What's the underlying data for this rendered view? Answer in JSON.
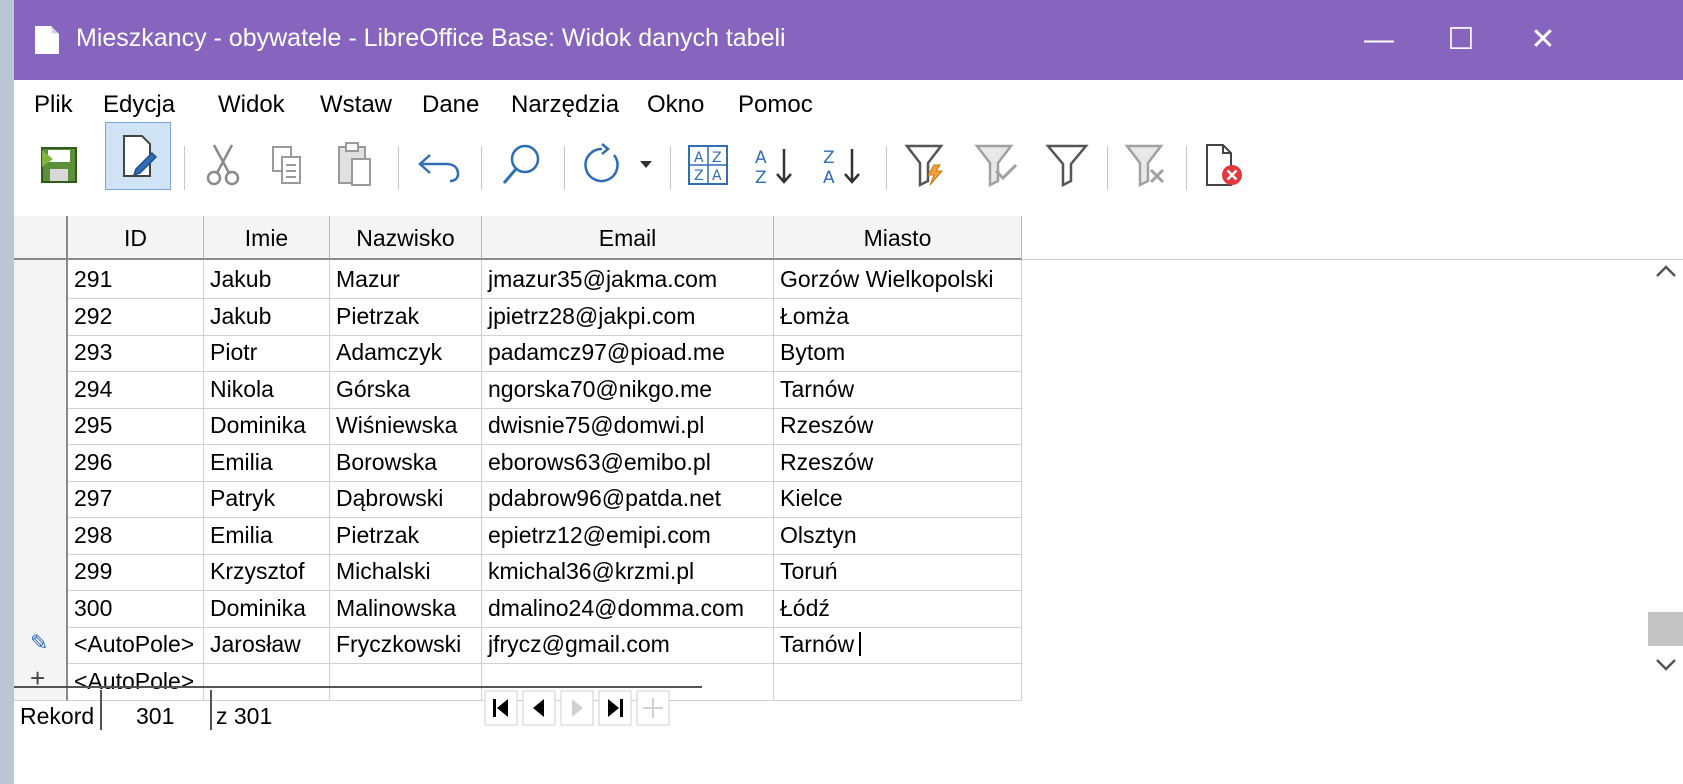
{
  "window": {
    "title": "Mieszkancy - obywatele - LibreOffice Base: Widok danych tabeli",
    "minimize_glyph": "—",
    "maximize_glyph": "☐",
    "close_glyph": "✕"
  },
  "menu": [
    {
      "label": "Plik"
    },
    {
      "label": "Edycja"
    },
    {
      "label": "Widok"
    },
    {
      "label": "Wstaw"
    },
    {
      "label": "Dane"
    },
    {
      "label": "Narzędzia"
    },
    {
      "label": "Okno"
    },
    {
      "label": "Pomoc"
    }
  ],
  "toolbar": {
    "icons": [
      "save-record-icon",
      "edit-data-icon",
      "cut-icon",
      "copy-icon",
      "paste-icon",
      "undo-icon",
      "find-icon",
      "refresh-icon",
      "refresh-dropdown-icon",
      "sort-icon",
      "sort-ascending-icon",
      "sort-descending-icon",
      "autofilter-icon",
      "apply-filter-icon",
      "standard-filter-icon",
      "reset-filter-icon",
      "delete-record-icon"
    ]
  },
  "table": {
    "columns": [
      "ID",
      "Imie",
      "Nazwisko",
      "Email",
      "Miasto"
    ],
    "rows": [
      [
        "291",
        "Jakub",
        "Mazur",
        "jmazur35@jakma.com",
        "Gorzów Wielkopolski"
      ],
      [
        "292",
        "Jakub",
        "Pietrzak",
        "jpietrz28@jakpi.com",
        "Łomża"
      ],
      [
        "293",
        "Piotr",
        "Adamczyk",
        "padamcz97@pioad.me",
        "Bytom"
      ],
      [
        "294",
        "Nikola",
        "Górska",
        "ngorska70@nikgo.me",
        "Tarnów"
      ],
      [
        "295",
        "Dominika",
        "Wiśniewska",
        "dwisnie75@domwi.pl",
        "Rzeszów"
      ],
      [
        "296",
        "Emilia",
        "Borowska",
        "eborows63@emibo.pl",
        "Rzeszów"
      ],
      [
        "297",
        "Patryk",
        "Dąbrowski",
        "pdabrow96@patda.net",
        "Kielce"
      ],
      [
        "298",
        "Emilia",
        "Pietrzak",
        "epietrz12@emipi.com",
        "Olsztyn"
      ],
      [
        "299",
        "Krzysztof",
        "Michalski",
        "kmichal36@krzmi.pl",
        "Toruń"
      ],
      [
        "300",
        "Dominika",
        "Malinowska",
        "dmalino24@domma.com",
        "Łódź"
      ],
      [
        "<AutoPole>",
        "Jarosław",
        "Fryczkowski",
        "jfrycz@gmail.com",
        "Tarnów"
      ],
      [
        "<AutoPole>",
        "",
        "",
        "",
        ""
      ]
    ],
    "row_markers": [
      "",
      "",
      "",
      "",
      "",
      "",
      "",
      "",
      "",
      "",
      "pencil",
      "plus"
    ],
    "edit_row_marker_glyph": "✎",
    "new_row_marker_glyph": "+"
  },
  "navigation": {
    "record_label": "Rekord",
    "record_value": "301",
    "of_label": "z 301"
  },
  "colors": {
    "titlebar": "#8765bf",
    "accent_blue": "#2f6db5",
    "grid_header": "#f4f4f4"
  }
}
